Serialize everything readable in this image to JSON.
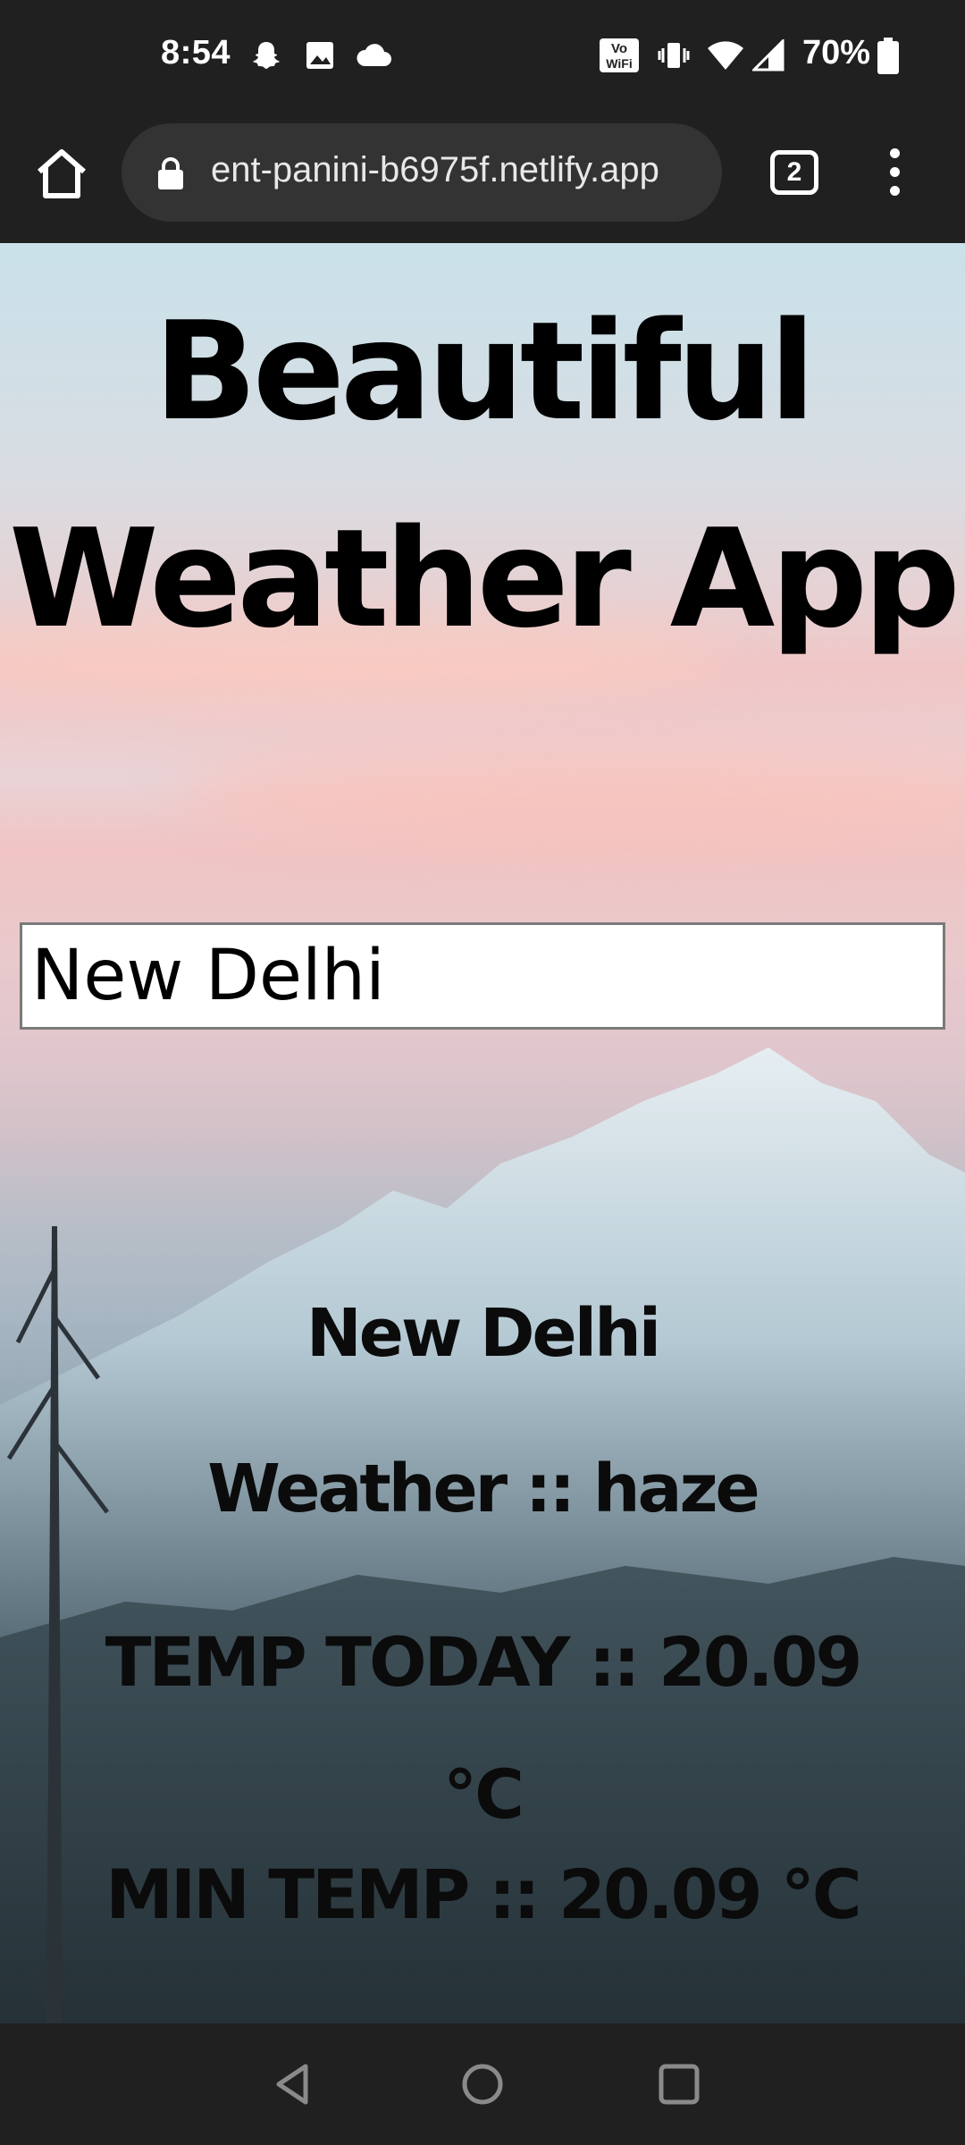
{
  "status_bar": {
    "time": "8:54",
    "battery": "70%",
    "icons": [
      "snapchat-icon",
      "image-icon",
      "cloud-icon",
      "vowifi-icon",
      "vibrate-icon",
      "wifi-icon",
      "signal-icon",
      "battery-icon"
    ]
  },
  "browser": {
    "url": "ent-panini-b6975f.netlify.app",
    "tab_count": "2"
  },
  "page": {
    "title": "Beautiful Weather App",
    "search_value": "New Delhi",
    "city": "New Delhi",
    "weather": "Weather :: haze",
    "temp_today": "TEMP TODAY :: 20.09 °C",
    "min_temp": "MIN TEMP :: 20.09 °C"
  },
  "colors": {
    "system_bar": "#202020",
    "url_pill": "#333333",
    "text": "#000000"
  }
}
